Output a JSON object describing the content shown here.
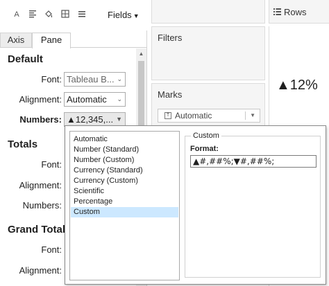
{
  "toolbar": {
    "icons": [
      "font-icon",
      "align-icon",
      "shading-icon",
      "borders-icon",
      "lines-icon"
    ],
    "fields_label": "Fields"
  },
  "tabs": [
    {
      "label": "Axis",
      "active": false
    },
    {
      "label": "Pane",
      "active": true
    }
  ],
  "default_section": {
    "title": "Default",
    "font_label": "Font:",
    "font_value": "Tableau B...",
    "alignment_label": "Alignment:",
    "alignment_value": "Automatic",
    "numbers_label": "Numbers:",
    "numbers_value": "▲12,345,..."
  },
  "totals_section": {
    "title": "Totals",
    "font_label": "Font:",
    "alignment_label": "Alignment:",
    "numbers_label": "Numbers:"
  },
  "grand_total_section": {
    "title": "Grand Total",
    "font_label": "Font:",
    "alignment_label": "Alignment:"
  },
  "shelves": {
    "filters_title": "Filters",
    "marks_title": "Marks",
    "marks_type": "Automatic",
    "rows_label": "Rows"
  },
  "view": {
    "value_text": "▲12%"
  },
  "number_format_popup": {
    "options": [
      "Automatic",
      "Number (Standard)",
      "Number (Custom)",
      "Currency (Standard)",
      "Currency (Custom)",
      "Scientific",
      "Percentage",
      "Custom"
    ],
    "selected_option": "Custom",
    "group_title": "Custom",
    "format_label": "Format:",
    "format_value": "▲#,##%;▼#,##%;"
  },
  "colors": {
    "selection": "#cce8ff",
    "shelf_background": "#f5f5f5",
    "border": "#dcdcdc"
  }
}
